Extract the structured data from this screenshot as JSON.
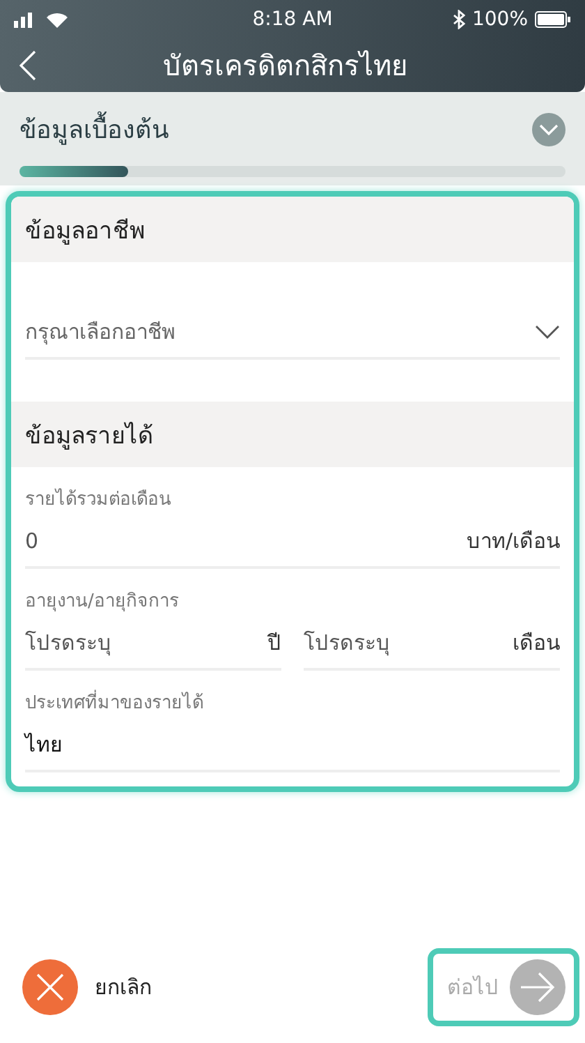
{
  "status_bar": {
    "time": "8:18 AM",
    "battery": "100%"
  },
  "nav": {
    "title": "บัตรเครดิตกสิกรไทย"
  },
  "step": {
    "title": "ข้อมูลเบื้องต้น",
    "expanded": false,
    "level": 0.2
  },
  "form": {
    "highlighted": true,
    "occupation": {
      "heading": "ข้อมูลอาชีพ",
      "placeholder": "กรุณาเลือกอาชีพ"
    },
    "income": {
      "heading": "ข้อมูลรายได้",
      "fields": [
        {
          "kind": "single",
          "label": "รายได้รวมต่อเดือน",
          "value": "0",
          "unit": "บาท/เดือน"
        },
        {
          "kind": "pair",
          "label": "อายุงาน/อายุกิจการ",
          "parts": [
            {
              "placeholder": "โปรดระบุ",
              "unit": "ปี"
            },
            {
              "placeholder": "โปรดระบุ",
              "unit": "เดือน"
            }
          ]
        },
        {
          "kind": "single",
          "label": "ประเทศที่มาของรายได้",
          "value": "ไทย",
          "dark": true
        }
      ]
    }
  },
  "footer": {
    "cancel": {
      "label": "ยกเลิก"
    },
    "next": {
      "label": "ต่อไป",
      "disabled": true,
      "highlighted": true
    }
  }
}
